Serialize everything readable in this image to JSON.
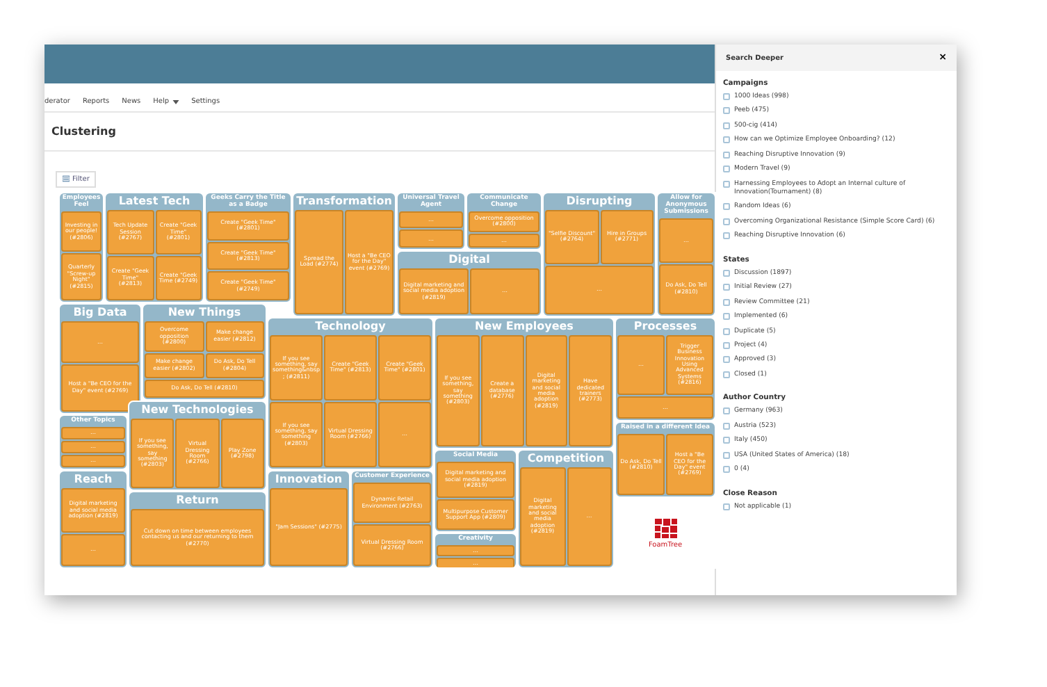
{
  "nav": {
    "items": [
      {
        "label": "derator",
        "has_menu": false
      },
      {
        "label": "Reports",
        "has_menu": false
      },
      {
        "label": "News",
        "has_menu": false
      },
      {
        "label": "Help",
        "has_menu": true
      },
      {
        "label": "Settings",
        "has_menu": false
      }
    ]
  },
  "page_title": "Clustering",
  "filter_button": "Filter",
  "treemap": {
    "logo": "FoamTree",
    "groups": [
      {
        "title": "Employees Feel",
        "kind": "small",
        "cells": [
          "Investing in our people! (#2806)",
          "Quarterly \"Screw-up Night\" (#2815)"
        ]
      },
      {
        "title": "Latest Tech",
        "kind": "large",
        "cells": [
          "Tech Update Session (#2767)",
          "Create \"Geek Time\" (#2801)",
          "Create \"Geek Time\" (#2813)",
          "Create \"Geek Time (#2749)"
        ]
      },
      {
        "title": "Geeks Carry the Title as a Badge",
        "kind": "small",
        "cells": [
          "Create \"Geek Time\" (#2801)",
          "Create \"Geek Time\" (#2813)",
          "Create \"Geek Time\" (#2749)"
        ]
      },
      {
        "title": "Transformation",
        "kind": "large",
        "cells": [
          "Spread the Load (#2774)",
          "Host a \"Be CEO for the Day\" event (#2769)"
        ]
      },
      {
        "title": "Universal Travel Agent",
        "kind": "small",
        "cells": [
          "…",
          "…"
        ]
      },
      {
        "title": "Communicate Change",
        "kind": "small",
        "cells": [
          "Overcome opposition (#2800)",
          "…"
        ]
      },
      {
        "title": "Disrupting",
        "kind": "large",
        "cells": [
          "\"Selfie Discount\" (#2764)",
          "Hire in Groups (#2771)",
          "…"
        ]
      },
      {
        "title": "Allow for Anonymous Submissions",
        "kind": "small",
        "cells": [
          "…",
          "Do Ask, Do Tell (#2810)"
        ]
      },
      {
        "title": "Digital",
        "kind": "large",
        "cells": [
          "Digital marketing and social media adoption (#2819)",
          "…"
        ]
      },
      {
        "title": "Big Data",
        "kind": "large",
        "cells": [
          "…",
          "Host a \"Be CEO for the Day\" event (#2769)"
        ]
      },
      {
        "title": "New Things",
        "kind": "large",
        "cells": [
          "Overcome opposition (#2800)",
          "Make change easier (#2812)",
          "Make change easier (#2802)",
          "Do Ask, Do Tell (#2804)",
          "Do Ask, Do Tell (#2810)"
        ]
      },
      {
        "title": "Technology",
        "kind": "large",
        "cells": [
          "If you see something, say something&nbsp; (#2811)",
          "Create \"Geek Time\" (#2813)",
          "Create \"Geek Time\" (#2801)",
          "If you see something, say something (#2803)",
          "Virtual Dressing Room (#2766)",
          "…"
        ]
      },
      {
        "title": "New Employees",
        "kind": "large",
        "cells": [
          "If you see something, say something (#2803)",
          "Create a database (#2776)",
          "Digital marketing and social media adoption (#2819)",
          "Have dedicated trainers (#2773)"
        ]
      },
      {
        "title": "Processes",
        "kind": "large",
        "cells": [
          "…",
          "Trigger Business Innovation Using Advanced Systems (#2816)",
          "…"
        ]
      },
      {
        "title": "Other Topics",
        "kind": "small",
        "cells": [
          "…",
          "…",
          "…"
        ]
      },
      {
        "title": "New Technologies",
        "kind": "large",
        "cells": [
          "If you see something, say something (#2803)",
          "Virtual Dressing Room (#2766)",
          "Play Zone (#2798)"
        ]
      },
      {
        "title": "Social Media",
        "kind": "small",
        "cells": [
          "Digital marketing and social media adoption (#2819)",
          "Multipurpose Customer Support App (#2809)"
        ]
      },
      {
        "title": "Raised in a different Idea",
        "kind": "small",
        "cells": [
          "Do Ask, Do Tell (#2810)",
          "Host a \"Be CEO for the Day\" event (#2769)"
        ]
      },
      {
        "title": "Competition",
        "kind": "large",
        "cells": [
          "Digital marketing and social media adoption (#2819)",
          "…"
        ]
      },
      {
        "title": "Reach",
        "kind": "large",
        "cells": [
          "Digital marketing and social media adoption (#2819)",
          "…"
        ]
      },
      {
        "title": "Return",
        "kind": "large",
        "cells": [
          "Cut down on time between employees contacting us and our returning to them (#2770)"
        ]
      },
      {
        "title": "Innovation",
        "kind": "large",
        "cells": [
          "\"Jam Sessions\" (#2775)"
        ]
      },
      {
        "title": "Customer Experience",
        "kind": "small",
        "cells": [
          "Dynamic Retail Environment (#2763)",
          "Virtual Dressing Room (#2766)"
        ]
      },
      {
        "title": "Creativity",
        "kind": "small",
        "cells": [
          "…",
          "…"
        ]
      }
    ]
  },
  "panel": {
    "title": "Search Deeper",
    "close": "×",
    "sections": [
      {
        "heading": "Campaigns",
        "items": [
          {
            "label": "1000 Ideas (998)",
            "checked": false
          },
          {
            "label": "Peeb (475)",
            "checked": false
          },
          {
            "label": "500-cig (414)",
            "checked": false
          },
          {
            "label": "How can we Optimize Employee Onboarding? (12)",
            "checked": false
          },
          {
            "label": "Reaching Disruptive Innovation (9)",
            "checked": false
          },
          {
            "label": "Modern Travel (9)",
            "checked": false
          },
          {
            "label": "Harnessing Employees to Adopt an Internal culture of Innovation(Tournament) (8)",
            "checked": false
          },
          {
            "label": "Random Ideas (6)",
            "checked": false
          },
          {
            "label": "Overcoming Organizational Resistance (Simple Score Card) (6)",
            "checked": false
          },
          {
            "label": "Reaching Disruptive Innovation (6)",
            "checked": false
          }
        ]
      },
      {
        "heading": "States",
        "items": [
          {
            "label": "Discussion (1897)",
            "checked": false
          },
          {
            "label": "Initial Review (27)",
            "checked": false
          },
          {
            "label": "Review Committee (21)",
            "checked": false
          },
          {
            "label": "Implemented (6)",
            "checked": false
          },
          {
            "label": "Duplicate (5)",
            "checked": false
          },
          {
            "label": "Project (4)",
            "checked": false
          },
          {
            "label": "Approved (3)",
            "checked": false
          },
          {
            "label": "Closed (1)",
            "checked": false
          }
        ]
      },
      {
        "heading": "Author Country",
        "items": [
          {
            "label": "Germany (963)",
            "checked": false
          },
          {
            "label": "Austria (523)",
            "checked": false
          },
          {
            "label": "Italy (450)",
            "checked": false
          },
          {
            "label": "USA (United States of America) (18)",
            "checked": false
          },
          {
            "label": "0 (4)",
            "checked": false
          }
        ]
      },
      {
        "heading": "Close Reason",
        "items": [
          {
            "label": "Not applicable (1)",
            "checked": false
          }
        ]
      }
    ]
  }
}
